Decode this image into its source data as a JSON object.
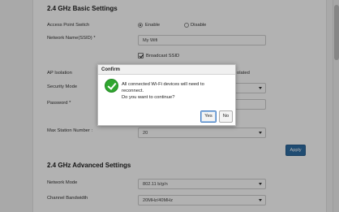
{
  "basic": {
    "title": "2.4 GHz Basic Settings",
    "access_point_switch_label": "Access Point Switch",
    "enable_label": "Enable",
    "disable_label": "Disable",
    "network_name_label": "Network Name(SSID) *",
    "network_name_value": "My Wifi",
    "broadcast_ssid_label": "Broadcast SSID",
    "ap_isolation_label": "AP Isolation",
    "isolated_label": "olated",
    "security_mode_label": "Security Mode",
    "password_label": "Password *",
    "max_station_label": "Max Station Number :",
    "max_station_value": "20",
    "apply_label": "Apply"
  },
  "advanced": {
    "title": "2.4 GHz Advanced Settings",
    "network_mode_label": "Network Mode",
    "network_mode_value": "802.11 b/g/n",
    "channel_bandwidth_label": "Channel Bandwidth",
    "channel_bandwidth_value": "20MHz/40MHz"
  },
  "dialog": {
    "title": "Confirm",
    "line1": "All connected Wi-Fi devices will need to",
    "line2": "reconnect.",
    "line3": "Do you want to continue?",
    "yes_label": "Yes",
    "no_label": "No"
  }
}
